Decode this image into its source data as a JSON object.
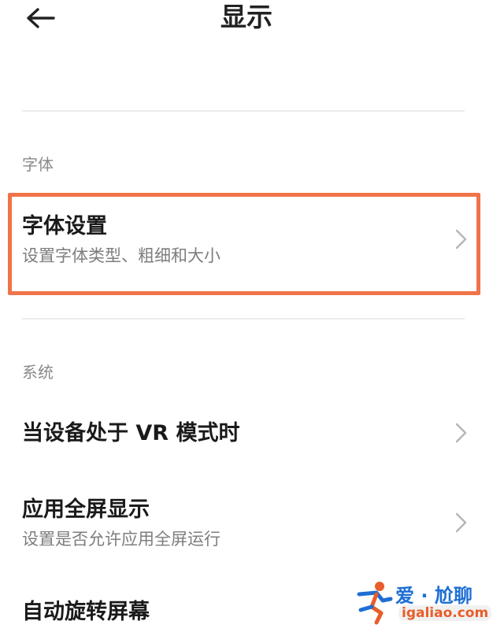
{
  "header": {
    "title": "显示",
    "back_icon": "arrow-left-icon"
  },
  "sections": [
    {
      "label": "字体",
      "items": [
        {
          "title": "字体设置",
          "subtitle": "设置字体类型、粗细和大小",
          "highlighted": true
        }
      ]
    },
    {
      "label": "系统",
      "items": [
        {
          "title": "当设备处于 VR 模式时",
          "subtitle": ""
        },
        {
          "title": "应用全屏显示",
          "subtitle": "设置是否允许应用全屏运行"
        },
        {
          "title": "自动旋转屏幕",
          "subtitle": ""
        }
      ]
    }
  ],
  "colors": {
    "highlight": "#f0734a",
    "watermark_blue": "#1e6fd4",
    "watermark_orange": "#e85d2a"
  },
  "watermark": {
    "line1": "爱 · 尬聊",
    "line2": "igaliao.com"
  }
}
